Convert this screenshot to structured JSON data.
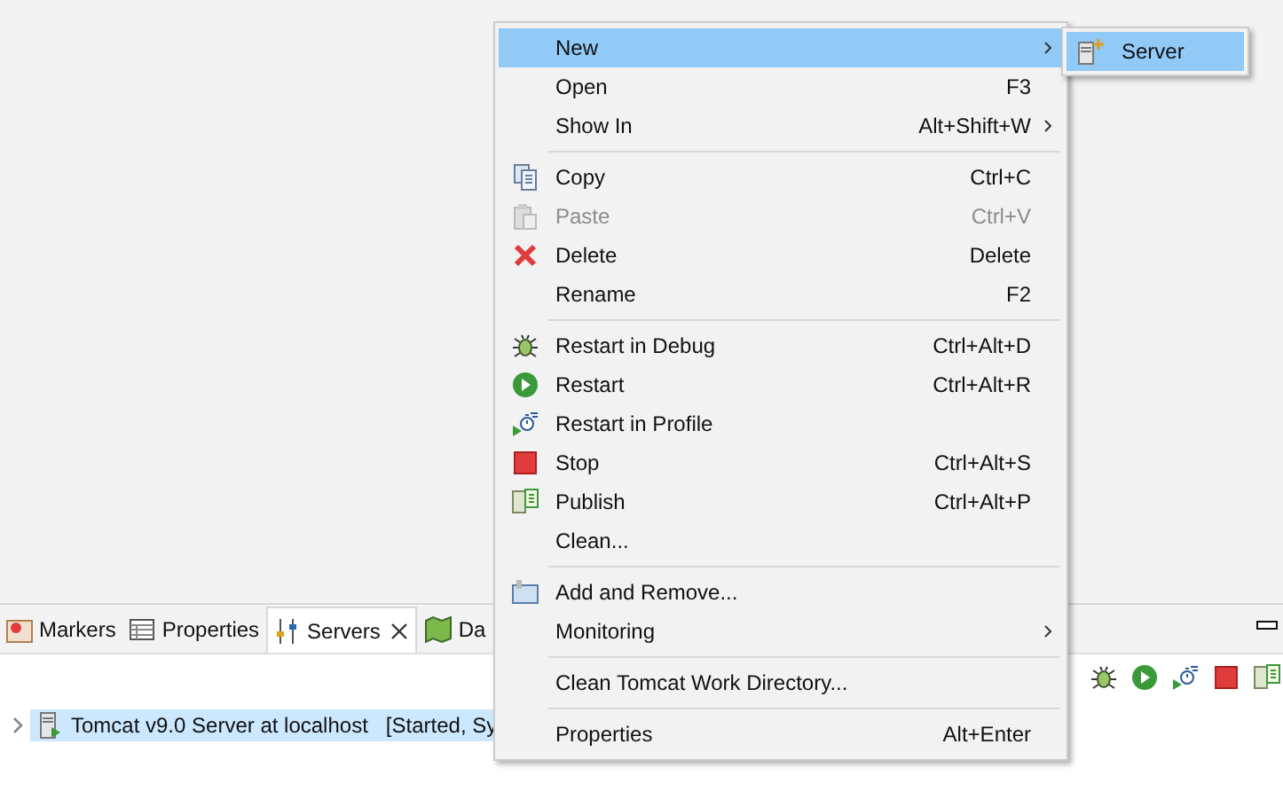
{
  "panel": {
    "tabs": [
      {
        "label": "Markers",
        "selected": false
      },
      {
        "label": "Properties",
        "selected": false
      },
      {
        "label": "Servers",
        "selected": true
      },
      {
        "label": "Da",
        "selected": false
      }
    ],
    "tree": [
      {
        "label": "Tomcat v9.0 Server at localhost",
        "status": "[Started, Sy",
        "selected": true,
        "expanded": false
      }
    ]
  },
  "menu": {
    "items": [
      {
        "kind": "item",
        "label": "New",
        "submenu": true,
        "selected": true,
        "disabled": false
      },
      {
        "kind": "item",
        "label": "Open",
        "shortcut": "F3",
        "selected": false,
        "disabled": false
      },
      {
        "kind": "item",
        "label": "Show In",
        "shortcut": "Alt+Shift+W",
        "submenu": true,
        "selected": false,
        "disabled": false
      },
      {
        "kind": "separator"
      },
      {
        "kind": "item",
        "label": "Copy",
        "shortcut": "Ctrl+C",
        "selected": false,
        "disabled": false
      },
      {
        "kind": "item",
        "label": "Paste",
        "shortcut": "Ctrl+V",
        "selected": false,
        "disabled": true
      },
      {
        "kind": "item",
        "label": "Delete",
        "shortcut": "Delete",
        "selected": false,
        "disabled": false
      },
      {
        "kind": "item",
        "label": "Rename",
        "shortcut": "F2",
        "selected": false,
        "disabled": false
      },
      {
        "kind": "separator"
      },
      {
        "kind": "item",
        "label": "Restart in Debug",
        "shortcut": "Ctrl+Alt+D",
        "selected": false,
        "disabled": false
      },
      {
        "kind": "item",
        "label": "Restart",
        "shortcut": "Ctrl+Alt+R",
        "selected": false,
        "disabled": false
      },
      {
        "kind": "item",
        "label": "Restart in Profile",
        "selected": false,
        "disabled": false
      },
      {
        "kind": "item",
        "label": "Stop",
        "shortcut": "Ctrl+Alt+S",
        "selected": false,
        "disabled": false
      },
      {
        "kind": "item",
        "label": "Publish",
        "shortcut": "Ctrl+Alt+P",
        "selected": false,
        "disabled": false
      },
      {
        "kind": "item",
        "label": "Clean...",
        "selected": false,
        "disabled": false
      },
      {
        "kind": "separator"
      },
      {
        "kind": "item",
        "label": "Add and Remove...",
        "selected": false,
        "disabled": false
      },
      {
        "kind": "item",
        "label": "Monitoring",
        "submenu": true,
        "selected": false,
        "disabled": false
      },
      {
        "kind": "separator"
      },
      {
        "kind": "item",
        "label": "Clean Tomcat Work Directory...",
        "selected": false,
        "disabled": false
      },
      {
        "kind": "separator"
      },
      {
        "kind": "item",
        "label": "Properties",
        "shortcut": "Alt+Enter",
        "selected": false,
        "disabled": false
      }
    ]
  },
  "submenu": {
    "items": [
      {
        "label": "Server",
        "selected": true
      }
    ]
  }
}
